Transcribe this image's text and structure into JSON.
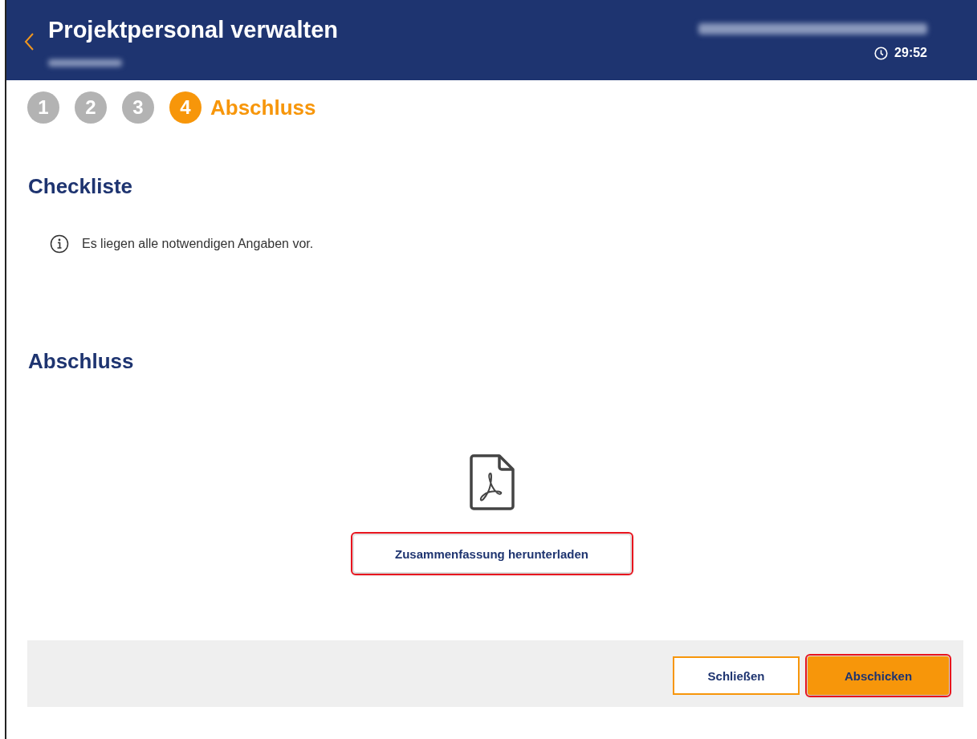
{
  "header": {
    "title": "Projektpersonal verwalten",
    "subtitle_redacted": true,
    "user_redacted": true,
    "timer": "29:52"
  },
  "steps": [
    {
      "number": "1",
      "selected": false
    },
    {
      "number": "2",
      "selected": false
    },
    {
      "number": "3",
      "selected": false
    },
    {
      "number": "4",
      "label": "Abschluss",
      "selected": true
    }
  ],
  "checklist": {
    "heading": "Checkliste",
    "messages": [
      {
        "kind": "info",
        "text": "Es liegen alle notwendigen Angaben vor."
      }
    ]
  },
  "completion": {
    "heading": "Abschluss",
    "download_button": {
      "label": "Zusammenfassung herunterladen",
      "highlighted": true
    }
  },
  "footer": {
    "buttons": [
      {
        "label": "Schließen",
        "kind": "secondary",
        "highlighted": false
      },
      {
        "label": "Abschicken",
        "kind": "primary",
        "highlighted": true
      }
    ]
  }
}
